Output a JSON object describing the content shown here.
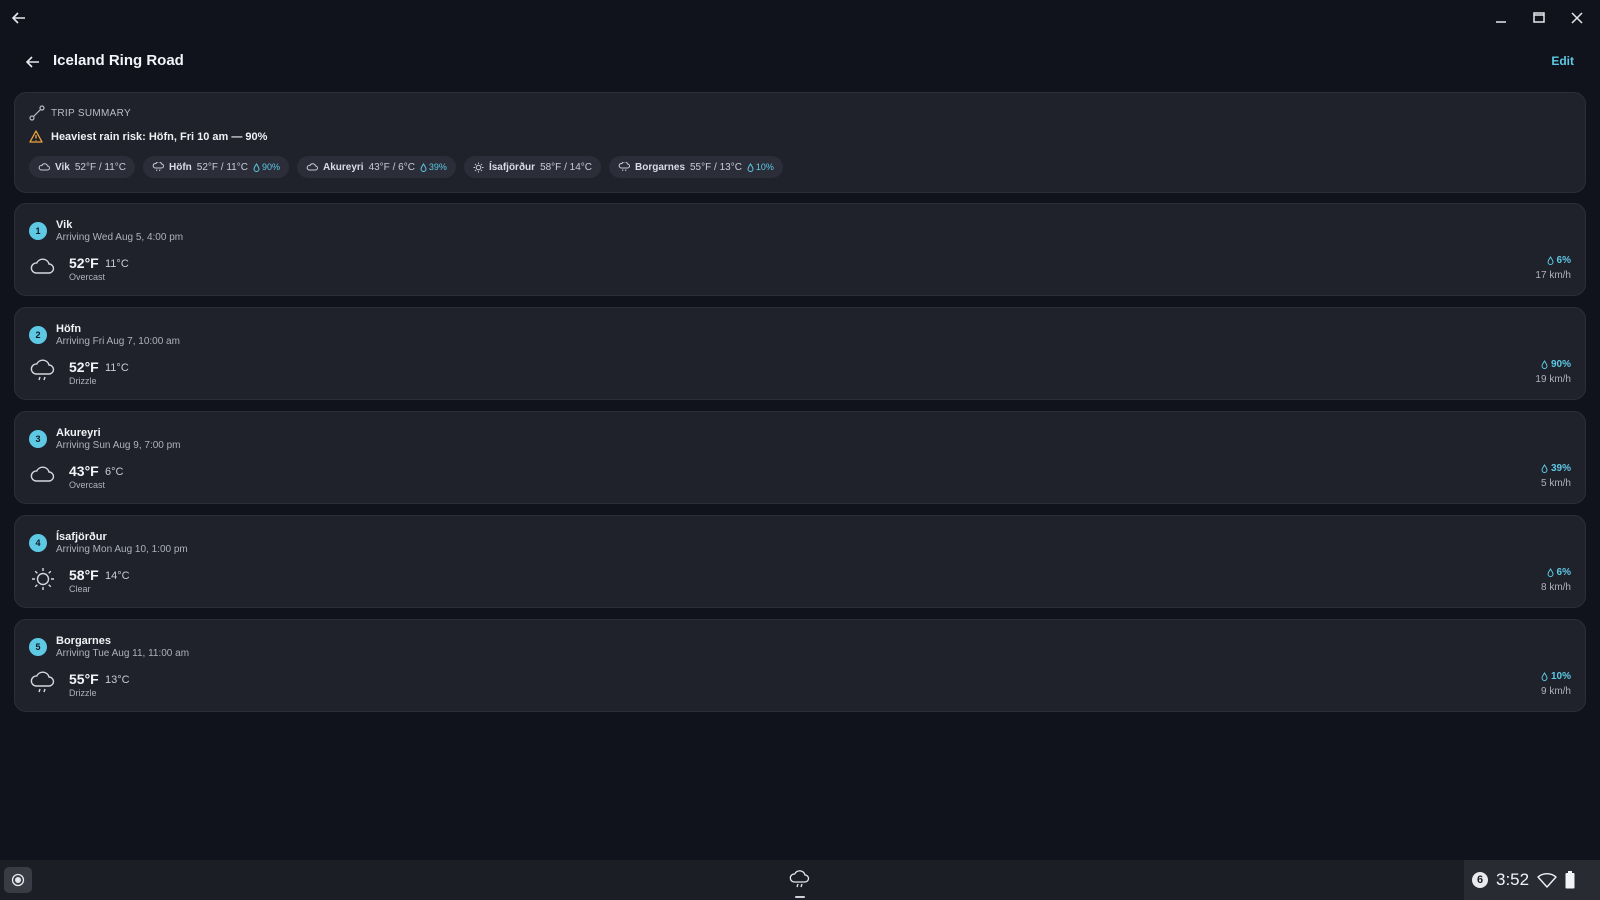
{
  "trip": {
    "title": "Iceland Ring Road",
    "edit_label": "Edit"
  },
  "summary": {
    "label": "TRIP SUMMARY",
    "risk": "Heaviest rain risk: Höfn, Fri 10 am — 90%",
    "chips": [
      {
        "name": "Vik",
        "temp": "52°F / 11°C",
        "precip": "",
        "icon": "cloud-icon"
      },
      {
        "name": "Höfn",
        "temp": "52°F / 11°C",
        "precip": "90%",
        "icon": "drizzle-icon"
      },
      {
        "name": "Akureyri",
        "temp": "43°F / 6°C",
        "precip": "39%",
        "icon": "cloud-icon"
      },
      {
        "name": "Ísafjörður",
        "temp": "58°F / 14°C",
        "precip": "",
        "icon": "sun-icon"
      },
      {
        "name": "Borgarnes",
        "temp": "55°F / 13°C",
        "precip": "10%",
        "icon": "drizzle-icon"
      }
    ]
  },
  "stops": [
    {
      "number": "1",
      "name": "Vik",
      "arrival": "Arriving Wed Aug 5, 4:00 pm",
      "temp_f": "52°F",
      "temp_c": "11°C",
      "condition": "Overcast",
      "precip": "6%",
      "wind": "17 km/h",
      "icon": "cloud-icon"
    },
    {
      "number": "2",
      "name": "Höfn",
      "arrival": "Arriving Fri Aug 7, 10:00 am",
      "temp_f": "52°F",
      "temp_c": "11°C",
      "condition": "Drizzle",
      "precip": "90%",
      "wind": "19 km/h",
      "icon": "drizzle-icon"
    },
    {
      "number": "3",
      "name": "Akureyri",
      "arrival": "Arriving Sun Aug 9, 7:00 pm",
      "temp_f": "43°F",
      "temp_c": "6°C",
      "condition": "Overcast",
      "precip": "39%",
      "wind": "5 km/h",
      "icon": "cloud-icon"
    },
    {
      "number": "4",
      "name": "Ísafjörður",
      "arrival": "Arriving Mon Aug 10, 1:00 pm",
      "temp_f": "58°F",
      "temp_c": "14°C",
      "condition": "Clear",
      "precip": "6%",
      "wind": "8 km/h",
      "icon": "sun-icon"
    },
    {
      "number": "5",
      "name": "Borgarnes",
      "arrival": "Arriving Tue Aug 11, 11:00 am",
      "temp_f": "55°F",
      "temp_c": "13°C",
      "condition": "Drizzle",
      "precip": "10%",
      "wind": "9 km/h",
      "icon": "drizzle-icon"
    }
  ],
  "taskbar": {
    "notification_count": "6",
    "time": "3:52"
  },
  "colors": {
    "accent": "#5ec9e4",
    "background": "#10121c",
    "card": "#1f212b",
    "warning": "#f0a63c"
  }
}
